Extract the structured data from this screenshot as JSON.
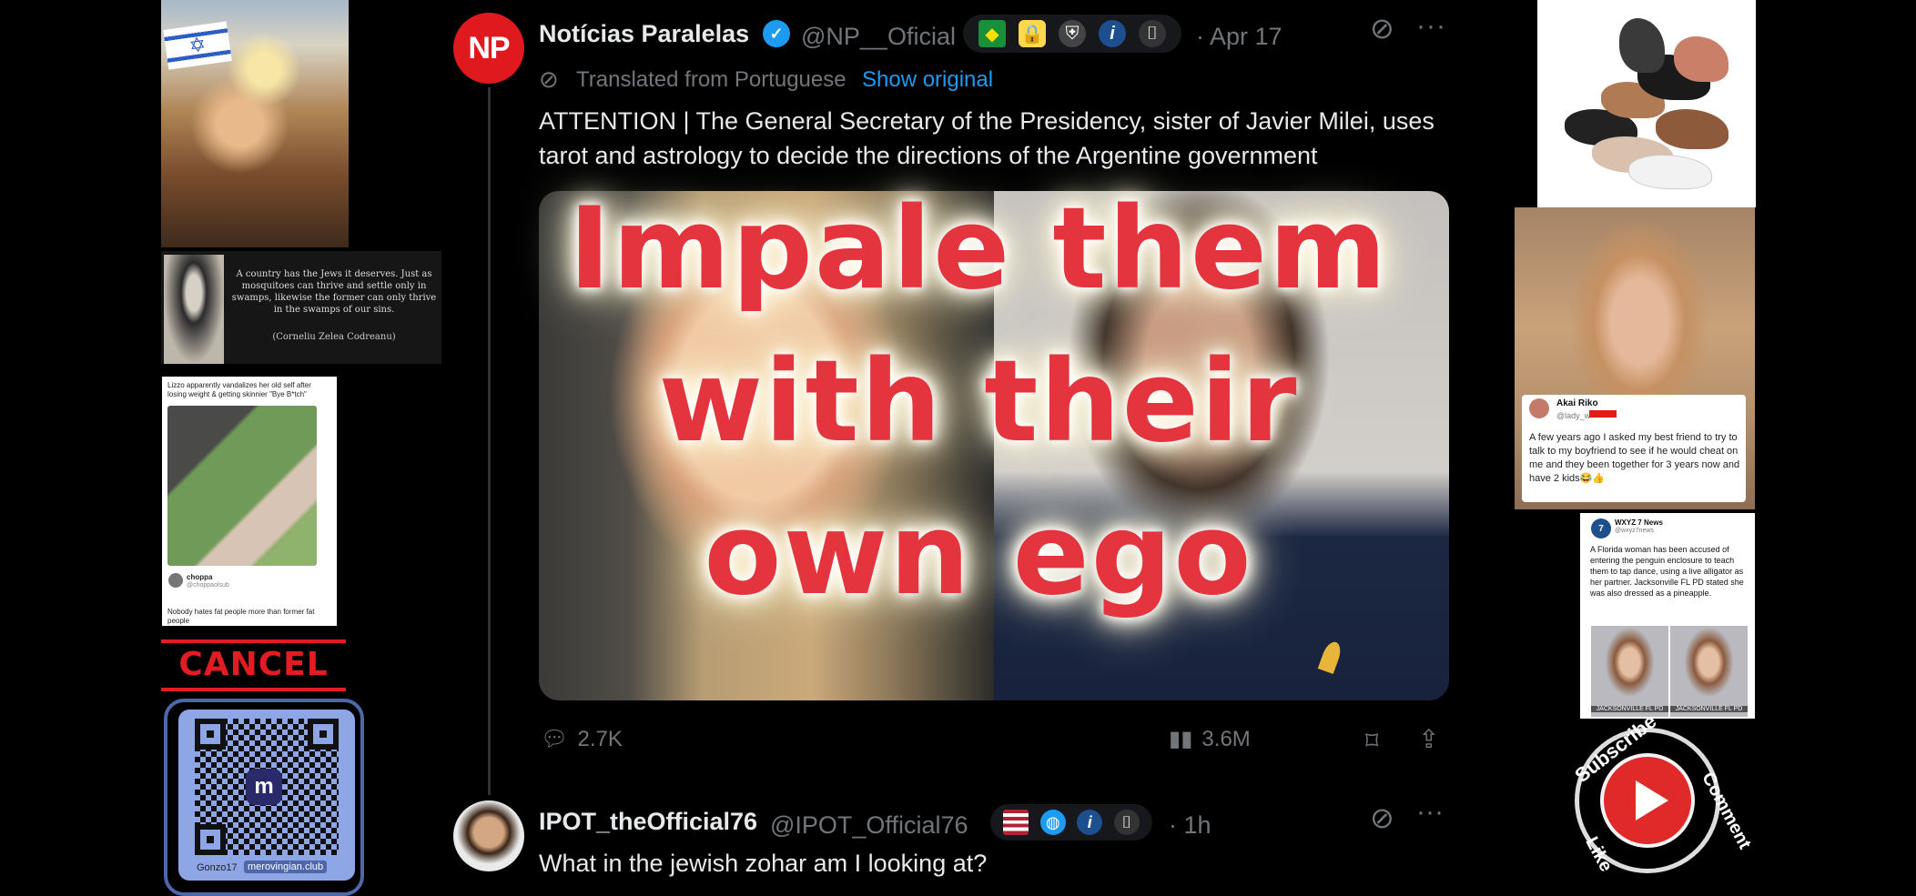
{
  "tweet": {
    "author_name": "Notícias Paralelas",
    "avatar_text": "NP",
    "handle": "@NP__Oficial",
    "date": "· Apr 17",
    "translated_label": "Translated from Portuguese",
    "show_original": "Show original",
    "text": "ATTENTION | The General Secretary of the Presidency, sister of Javier Milei, uses tarot and astrology to decide the directions of the Argentine government",
    "replies": "2.7K",
    "views": "3.6M"
  },
  "overlay": {
    "line1": "Impale them",
    "line2": "with their",
    "line3": "own ego"
  },
  "reply": {
    "author_name": "IPOT_theOfficial76",
    "handle": "@IPOT_Official76",
    "time": "· 1h",
    "text": "What in the jewish zohar am I looking at?"
  },
  "left_memes": {
    "quote_text": "A country has the Jews it deserves. Just as mosquitoes can thrive and settle only in swamps, likewise the former can only thrive in the swamps of our sins.",
    "quote_author": "(Corneliu Zelea Codreanu)",
    "lizzo_caption": "Lizzo apparently vandalizes her old self after losing weight & getting skinnier \"Bye B*tch\"",
    "lizzo_user": "choppa",
    "lizzo_handle": "@choppaolsub",
    "lizzo_body": "Nobody hates fat people more than former fat people",
    "cancel_label": "CANCEL",
    "qr_user": "Gonzo17",
    "qr_site": "merovingian.club"
  },
  "right_memes": {
    "akai_name": "Akai Riko",
    "akai_handle": "@lady_w",
    "akai_text": "A few years ago I asked my best friend to try to talk to my boyfriend to see if he would cheat on me and they been together for 3 years now and have 2 kids😂👍",
    "wxyz_name": "WXYZ 7 News",
    "wxyz_handle": "@wxyz7news",
    "wxyz_text": "A Florida woman has been accused of entering the penguin enclosure to teach them to tap dance, using a live alligator as her partner. Jacksonville FL PD stated she was also dressed as a pineapple.",
    "mug_label_1": "JACKSONVILLE FL PD",
    "mug_label_2": "JACKSONVILLE FL PD",
    "sub_subscribe": "Subscribe",
    "sub_comment": "Comment",
    "sub_like": "Like"
  },
  "colors": {
    "overlay_text": "#e4343e",
    "link_blue": "#1d9bf0",
    "cancel_red": "#e31b23"
  }
}
